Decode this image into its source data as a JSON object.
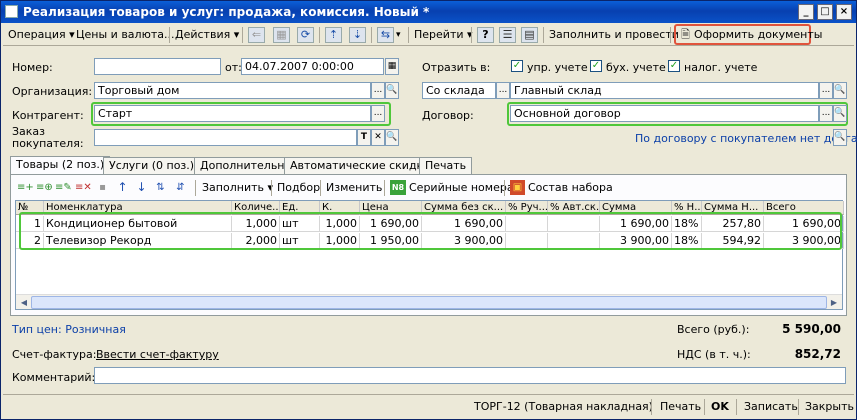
{
  "window": {
    "title": "Реализация товаров и услуг: продажа, комиссия. Новый *",
    "minimize": "_",
    "maximize": "□",
    "close": "×"
  },
  "toolbar": {
    "operation": "Операция",
    "prices": "Цены и валюта...",
    "actions": "Действия",
    "goto": "Перейти",
    "help": "?",
    "fill_and_post": "Заполнить и провести",
    "make_docs": "Оформить документы",
    "dropdown_arrow": "▾"
  },
  "header": {
    "number_label": "Номер:",
    "number_value": "",
    "date_label": "от:",
    "date_value": "04.07.2007  0:00:00",
    "reflect_label": "Отразить в:",
    "chk_mgmt": "упр. учете",
    "chk_acct": "бух. учете",
    "chk_tax": "налог. учете",
    "org_label": "Организация:",
    "org_value": "Торговый дом",
    "wh_kind": "Со склада",
    "wh_value": "Главный склад",
    "counterparty_label": "Контрагент:",
    "counterparty_value": "Старт",
    "contract_label": "Договор:",
    "contract_value": "Основной договор",
    "order_label_1": "Заказ",
    "order_label_2": "покупателя:",
    "order_value": "",
    "no_debt_link": "По договору с покупателем нет долга",
    "ellipsis": "...",
    "search_glyph": "🔍",
    "t_glyph": "T",
    "x_glyph": "✕"
  },
  "tabs": [
    {
      "label": "Товары (2 поз.)"
    },
    {
      "label": "Услуги (0 поз.)"
    },
    {
      "label": "Дополнительно"
    },
    {
      "label": "Автоматические скидки"
    },
    {
      "label": "Печать"
    }
  ],
  "grid_toolbar": {
    "fill": "Заполнить",
    "selection": "Подбор",
    "change": "Изменить",
    "serials": "Серийные номера",
    "set": "Состав набора",
    "serial_badge": "N8"
  },
  "grid": {
    "columns": [
      "№",
      "Номенклатура",
      "Количе...",
      "Ед.",
      "К.",
      "Цена",
      "Сумма без ск...",
      "% Руч...",
      "% Авт.ск.",
      "Сумма",
      "% Н...",
      "Сумма Н...",
      "Всего"
    ],
    "rows": [
      [
        "1",
        "Кондиционер бытовой",
        "1,000",
        "шт",
        "1,000",
        "1 690,00",
        "1 690,00",
        "",
        "",
        "1 690,00",
        "18%",
        "257,80",
        "1 690,00"
      ],
      [
        "2",
        "Телевизор Рекорд",
        "2,000",
        "шт",
        "1,000",
        "1 950,00",
        "3 900,00",
        "",
        "",
        "3 900,00",
        "18%",
        "594,92",
        "3 900,00"
      ]
    ]
  },
  "footer": {
    "price_type_link": "Тип цен: Розничная",
    "total_label": "Всего (руб.):",
    "total_value": "5 590,00",
    "invoice_label": "Счет-фактура:",
    "invoice_link": "Ввести счет-фактуру",
    "vat_label": "НДС (в т. ч.):",
    "vat_value": "852,72",
    "comment_label": "Комментарий:",
    "comment_value": ""
  },
  "bottom": {
    "print_form": "ТОРГ-12 (Товарная накладная)",
    "print": "Печать",
    "ok": "OK",
    "save": "Записать",
    "close": "Закрыть"
  }
}
